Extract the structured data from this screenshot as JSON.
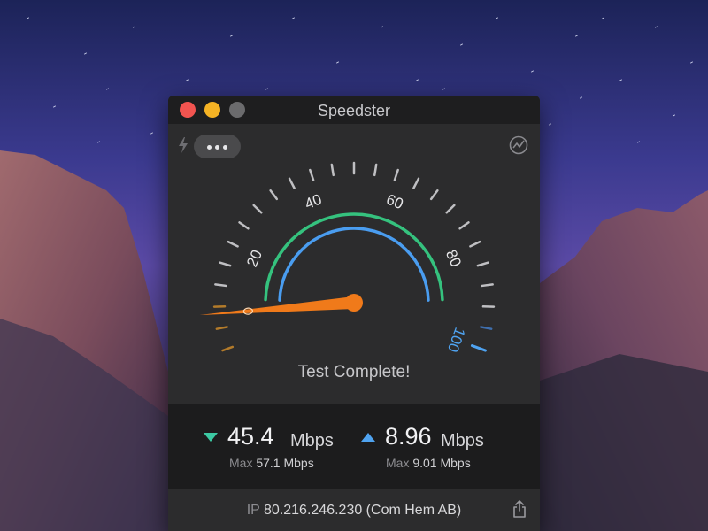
{
  "window": {
    "title": "Speedster"
  },
  "gauge": {
    "labels": [
      {
        "text": "20",
        "value": 20,
        "color": "#e6e6e8"
      },
      {
        "text": "40",
        "value": 40,
        "color": "#e6e6e8"
      },
      {
        "text": "60",
        "value": 60,
        "color": "#e6e6e8"
      },
      {
        "text": "80",
        "value": 80,
        "color": "#e6e6e8"
      },
      {
        "text": "100",
        "value": 100,
        "color": "#4fa3f0"
      }
    ],
    "needle_value": 7,
    "green_arc_color": "#35c27e",
    "blue_arc_color": "#4a9df0",
    "needle_color": "#f07a1a"
  },
  "status": {
    "text": "Test Complete!"
  },
  "results": {
    "download": {
      "value": "45.4",
      "unit": "Mbps",
      "max_label": "Max",
      "max_value": "57.1 Mbps",
      "arrow_color": "#3cc9a3"
    },
    "upload": {
      "value": "8.96",
      "unit": "Mbps",
      "max_label": "Max",
      "max_value": "9.01 Mbps",
      "arrow_color": "#4fa3f0"
    }
  },
  "footer": {
    "ip_label": "IP",
    "ip_value": "80.216.246.230 (Com Hem AB)"
  },
  "icons": {
    "bolt": "lightning-icon",
    "more": "ellipsis-icon",
    "graph": "graph-icon",
    "share": "share-icon"
  }
}
